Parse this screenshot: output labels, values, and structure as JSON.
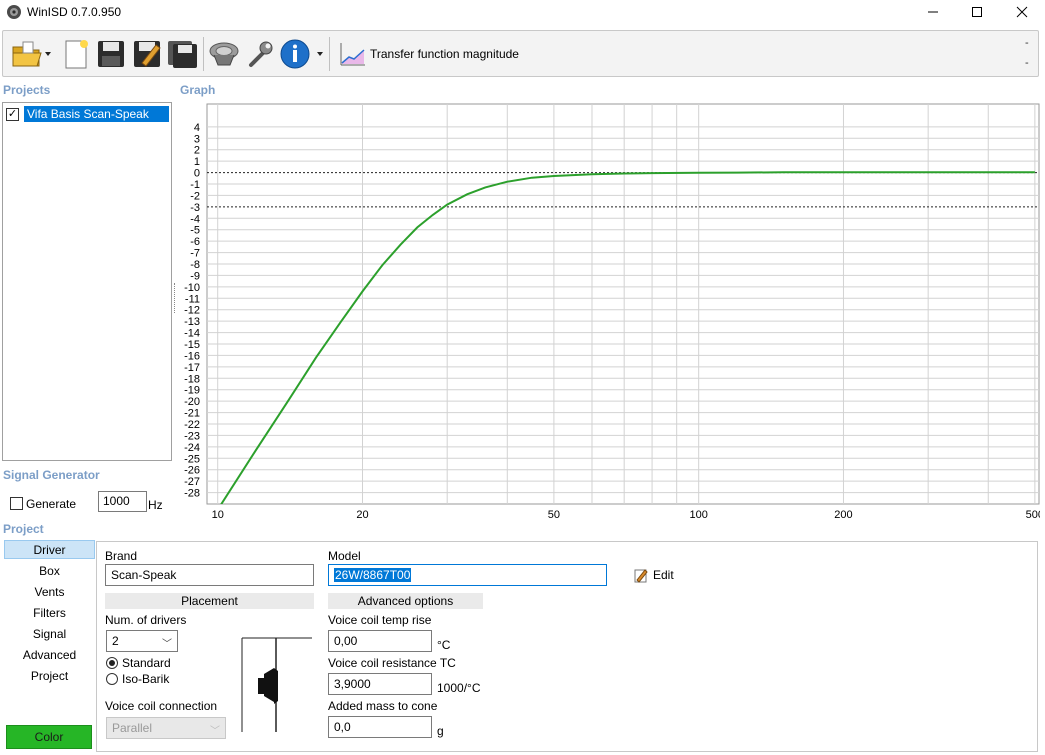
{
  "window": {
    "title": "WinISD 0.7.0.950"
  },
  "toolbar": {
    "graph_label": "Transfer function magnitude",
    "dash_top": "-",
    "dash_bottom": "-"
  },
  "projects": {
    "heading": "Projects",
    "items": [
      {
        "label": "Vifa Basis Scan-Speak",
        "checked": true
      }
    ]
  },
  "graph": {
    "heading": "Graph"
  },
  "chart_data": {
    "type": "line",
    "title": "",
    "xlabel": "",
    "ylabel": "",
    "x_scale": "log",
    "xlim": [
      9.5,
      510
    ],
    "ylim": [
      -29,
      6
    ],
    "x_tick_labels": [
      "10",
      "20",
      "50",
      "100",
      "200",
      "500"
    ],
    "y_tick_labels": [
      "4",
      "3",
      "2",
      "1",
      "0",
      "-1",
      "-2",
      "-3",
      "-4",
      "-5",
      "-6",
      "-7",
      "-8",
      "-9",
      "-10",
      "-11",
      "-12",
      "-13",
      "-14",
      "-15",
      "-16",
      "-17",
      "-18",
      "-19",
      "-20",
      "-21",
      "-22",
      "-23",
      "-24",
      "-25",
      "-26",
      "-27",
      "-28"
    ],
    "reference_lines": [
      0,
      -3
    ],
    "grid": true,
    "series": [
      {
        "color": "#2ca02c",
        "x": [
          10,
          12,
          14,
          16,
          18,
          20,
          22,
          24,
          26,
          28,
          30,
          33,
          36,
          40,
          45,
          50,
          60,
          70,
          80,
          100,
          120,
          150,
          200,
          300,
          500
        ],
        "y": [
          -29.5,
          -24.3,
          -20.0,
          -16.2,
          -13.1,
          -10.4,
          -8.1,
          -6.3,
          -4.8,
          -3.7,
          -2.8,
          -1.9,
          -1.3,
          -0.8,
          -0.45,
          -0.3,
          -0.15,
          -0.08,
          -0.05,
          -0.02,
          0.0,
          0.02,
          0.02,
          0.02,
          0.02
        ]
      }
    ]
  },
  "signal_generator": {
    "heading": "Signal Generator",
    "generate_label": "Generate",
    "frequency_value": "1000",
    "unit": "Hz"
  },
  "project": {
    "heading": "Project",
    "tabs": [
      "Driver",
      "Box",
      "Vents",
      "Filters",
      "Signal",
      "Advanced",
      "Project"
    ],
    "color_button": "Color"
  },
  "driver": {
    "brand_label": "Brand",
    "brand_value": "Scan-Speak",
    "model_label": "Model",
    "model_value": "26W/8867T00",
    "edit_label": "Edit",
    "placement_heading": "Placement",
    "num_drivers_label": "Num. of drivers",
    "num_drivers_value": "2",
    "standard_label": "Standard",
    "isobarik_label": "Iso-Barik",
    "vc_connection_label": "Voice coil connection",
    "vc_connection_value": "Parallel",
    "advanced_heading": "Advanced options",
    "vc_temp_rise_label": "Voice coil temp rise",
    "vc_temp_rise_value": "0,00",
    "vc_temp_rise_unit": "°C",
    "vc_resistance_tc_label": "Voice coil resistance TC",
    "vc_resistance_tc_value": "3,9000",
    "vc_resistance_tc_unit": "1000/°C",
    "added_mass_label": "Added mass to cone",
    "added_mass_value": "0,0",
    "added_mass_unit": "g"
  }
}
